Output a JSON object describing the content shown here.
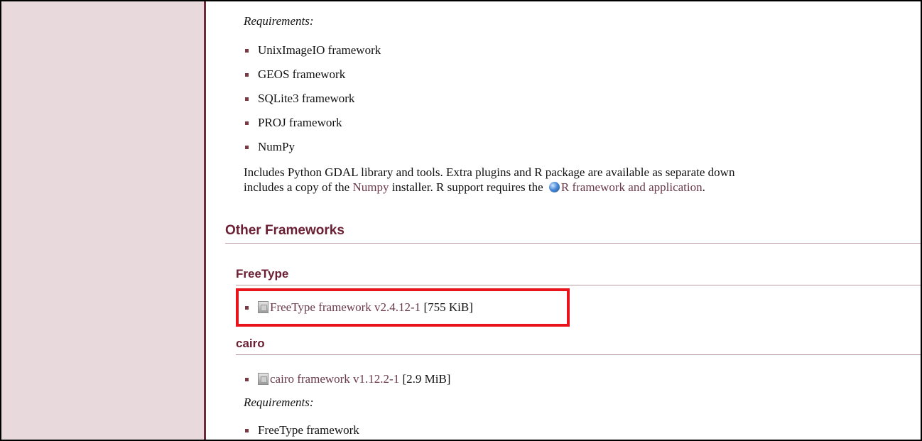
{
  "top_requirements": {
    "heading": "Requirements:",
    "items": [
      "UnixImageIO framework",
      "GEOS framework",
      "SQLite3 framework",
      "PROJ framework",
      "NumPy"
    ]
  },
  "gdal_note": {
    "line1": "Includes Python GDAL library and tools. Extra plugins and R package are available as separate down",
    "line2_prefix": "includes a copy of the ",
    "numpy_link": "Numpy",
    "line2_mid": " installer. R support requires the ",
    "r_link": "R framework and application",
    "line2_suffix": "."
  },
  "other_frameworks": {
    "heading": "Other Frameworks",
    "freetype": {
      "heading": "FreeType",
      "download_link": "FreeType framework v2.4.12-1",
      "size": "[755 KiB]"
    },
    "cairo": {
      "heading": "cairo",
      "download_link": "cairo framework v1.12.2-1",
      "size": "[2.9 MiB]",
      "requirements_heading": "Requirements:",
      "requirements": [
        "FreeType framework"
      ]
    }
  },
  "colors": {
    "sidebar_bg": "#e8d9dc",
    "sidebar_border": "#6b2a36",
    "heading": "#6b1f33",
    "link": "#6b3a4a",
    "highlight": "#e8131b"
  }
}
